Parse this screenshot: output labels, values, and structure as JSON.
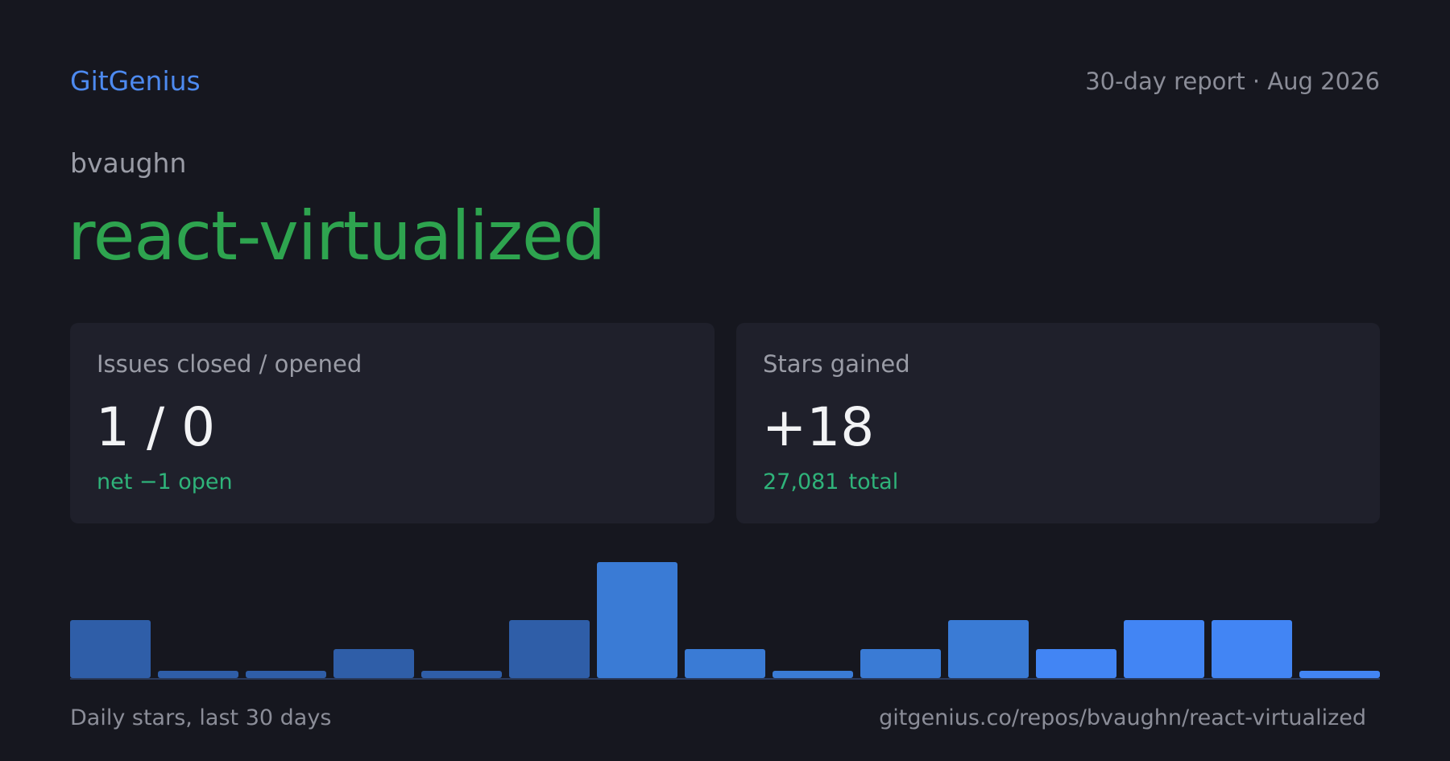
{
  "header": {
    "brand": "GitGenius",
    "report_label": "30-day report · Aug 2026"
  },
  "repo": {
    "owner": "bvaughn",
    "name": "react-virtualized"
  },
  "cards": {
    "issues": {
      "label": "Issues closed / opened",
      "value": "1 / 0",
      "sub": "net −1 open"
    },
    "stars": {
      "label": "Stars gained",
      "value": "+18",
      "sub_total": "27,081",
      "sub_suffix": "total"
    }
  },
  "footer": {
    "caption": "Daily stars, last 30 days",
    "url": "gitgenius.co/repos/bvaughn/react-virtualized"
  },
  "chart_data": {
    "type": "bar",
    "caption": "Daily stars, last 30 days",
    "values": [
      2,
      0.25,
      0.25,
      1,
      0.25,
      2,
      4,
      1,
      0.25,
      1,
      2,
      1,
      2,
      2,
      0.25
    ],
    "colors": [
      "#2f5ea8",
      "#2f5ea8",
      "#2f5ea8",
      "#2f5ea8",
      "#2f5ea8",
      "#2f5ea8",
      "#3a7bd5",
      "#3a7bd5",
      "#3a7bd5",
      "#3a7bd5",
      "#3a7bd5",
      "#4285f4",
      "#4285f4",
      "#4285f4",
      "#4285f4"
    ],
    "ylim": [
      0,
      4
    ],
    "grid": false
  }
}
